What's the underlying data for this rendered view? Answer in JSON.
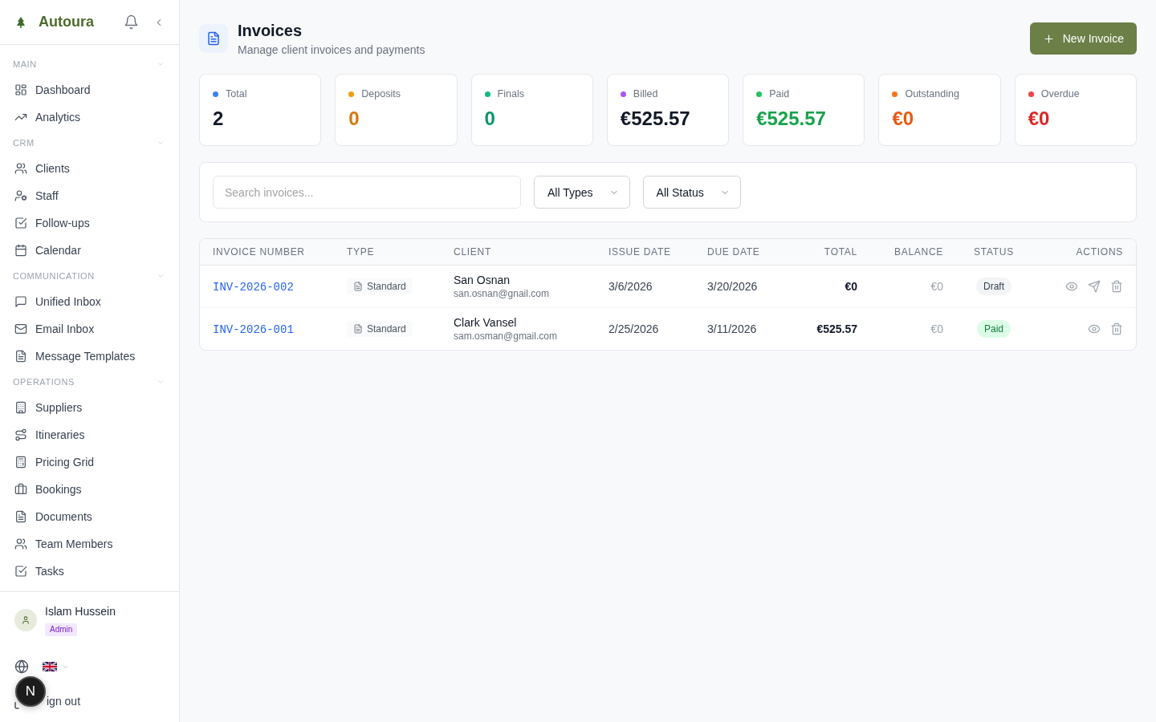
{
  "sidebar": {
    "brand": "Autoura",
    "sections": [
      {
        "title": "MAIN",
        "expanded": true,
        "items": [
          {
            "label": "Dashboard",
            "selected": false
          },
          {
            "label": "Analytics",
            "selected": false
          }
        ]
      },
      {
        "title": "CRM",
        "expanded": true,
        "items": [
          {
            "label": "Clients",
            "selected": false
          },
          {
            "label": "Staff",
            "selected": false
          },
          {
            "label": "Follow-ups",
            "selected": false
          },
          {
            "label": "Calendar",
            "selected": false
          }
        ]
      },
      {
        "title": "COMMUNICATION",
        "expanded": true,
        "items": [
          {
            "label": "Unified Inbox",
            "selected": false
          },
          {
            "label": "Email Inbox",
            "selected": false
          },
          {
            "label": "Message Templates",
            "selected": false
          }
        ]
      },
      {
        "title": "OPERATIONS",
        "expanded": true,
        "items": [
          {
            "label": "Suppliers",
            "selected": false
          },
          {
            "label": "Itineraries",
            "selected": false
          },
          {
            "label": "Pricing Grid",
            "selected": false
          },
          {
            "label": "Bookings",
            "selected": false
          },
          {
            "label": "Documents",
            "selected": false
          },
          {
            "label": "Team Members",
            "selected": false
          },
          {
            "label": "Tasks",
            "selected": false
          }
        ]
      }
    ],
    "user": {
      "name": "Islam Hussein",
      "role": "Admin"
    },
    "sign_out": "ign out",
    "dev_indicator": "N"
  },
  "page": {
    "title": "Invoices",
    "subtitle": "Manage client invoices and payments",
    "new_button": "New Invoice"
  },
  "stats": [
    {
      "label": "Total",
      "color": "#3b82f6",
      "value": {
        "text": "2",
        "color": "#111827"
      }
    },
    {
      "label": "Deposits",
      "color": "#f59e0b",
      "value": {
        "text": "0",
        "color": "#d97706"
      }
    },
    {
      "label": "Finals",
      "color": "#10b981",
      "value": {
        "text": "0",
        "color": "#059669"
      }
    },
    {
      "label": "Billed",
      "color": "#a855f7",
      "value": {
        "text": "€525.57",
        "color": "#111827"
      }
    },
    {
      "label": "Paid",
      "color": "#22c55e",
      "value": {
        "text": "€525.57",
        "color": "#16a34a"
      }
    },
    {
      "label": "Outstanding",
      "color": "#f97316",
      "value": {
        "text": "€0",
        "color": "#ea580c"
      }
    },
    {
      "label": "Overdue",
      "color": "#ef4444",
      "value": {
        "text": "€0",
        "color": "#dc2626"
      }
    }
  ],
  "filters": {
    "search": {
      "placeholder": "Search invoices..."
    },
    "selects": [
      {
        "value": "All Types"
      },
      {
        "value": "All Status"
      }
    ]
  },
  "table": {
    "columns": [
      "INVOICE NUMBER",
      "TYPE",
      "CLIENT",
      "ISSUE DATE",
      "DUE DATE",
      "TOTAL",
      "BALANCE",
      "STATUS",
      "ACTIONS"
    ],
    "rows": [
      {
        "invoice_number": "INV-2026-002",
        "type": "Standard",
        "client": {
          "name": "San Osnan",
          "email": "san.osnan@gnail.com"
        },
        "issue_date": "3/6/2026",
        "due_date": "3/20/2026",
        "total": "€0",
        "balance": "€0",
        "status": {
          "label": "Draft",
          "kind": "draft"
        },
        "actions": [
          {
            "kind": "view"
          },
          {
            "kind": "send"
          },
          {
            "kind": "delete"
          }
        ]
      },
      {
        "invoice_number": "INV-2026-001",
        "type": "Standard",
        "client": {
          "name": "Clark Vansel",
          "email": "sam.osman@gmail.com"
        },
        "issue_date": "2/25/2026",
        "due_date": "3/11/2026",
        "total": "€525.57",
        "balance": "€0",
        "status": {
          "label": "Paid",
          "kind": "paid"
        },
        "actions": [
          {
            "kind": "view"
          },
          {
            "kind": "delete"
          }
        ]
      }
    ]
  }
}
